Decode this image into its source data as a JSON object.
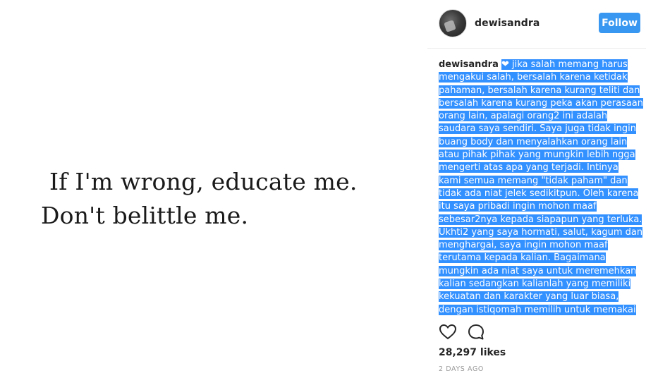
{
  "post": {
    "image_text": {
      "line1": "If I'm wrong, educate me.",
      "line2": "Don't belittle me."
    }
  },
  "header": {
    "username": "dewisandra",
    "follow_label": "Follow"
  },
  "caption": {
    "username": "dewisandra",
    "emoji": "❤",
    "lines": [
      "jika salah memang harus",
      "mengakui salah, bersalah karena ketidak",
      "pahaman, bersalah karena kurang teliti dan",
      "bersalah karena kurang peka akan perasaan",
      "orang lain, apalagi orang2 ini adalah",
      "saudara saya sendiri. Saya juga tidak ingin",
      "buang body dan menyalahkan orang lain",
      "atau pihak pihak yang mungkin lebih ngga",
      "mengerti atas apa yang terjadi. Intinya kami",
      "semua memang \"tidak paham\" dan tidak",
      "ada niat jelek sedikitpun. Oleh karena itu",
      "saya pribadi ingin mohon maaf",
      "sebesar2nya kepada siapapun yang terluka.",
      "Ukhti2 yang saya hormati, salut, kagum dan",
      "menghargai, saya ingin mohon maaf",
      "terutama kepada kalian. Bagaimana",
      "mungkin ada niat saya untuk meremehkan",
      "kalian sedangkan kalianlah yang memiliki",
      "kekuatan dan karakter yang luar biasa,",
      "dengan istiqomah memilih untuk memakai"
    ],
    "selection_color": "#3390ff"
  },
  "actions": {
    "like_icon": "heart-outline-icon",
    "comment_icon": "comment-bubble-icon"
  },
  "likes": "28,297 likes",
  "timestamp": "2 DAYS AGO",
  "colors": {
    "follow_button": "#3897f0",
    "text": "#262626",
    "muted": "#999999"
  }
}
